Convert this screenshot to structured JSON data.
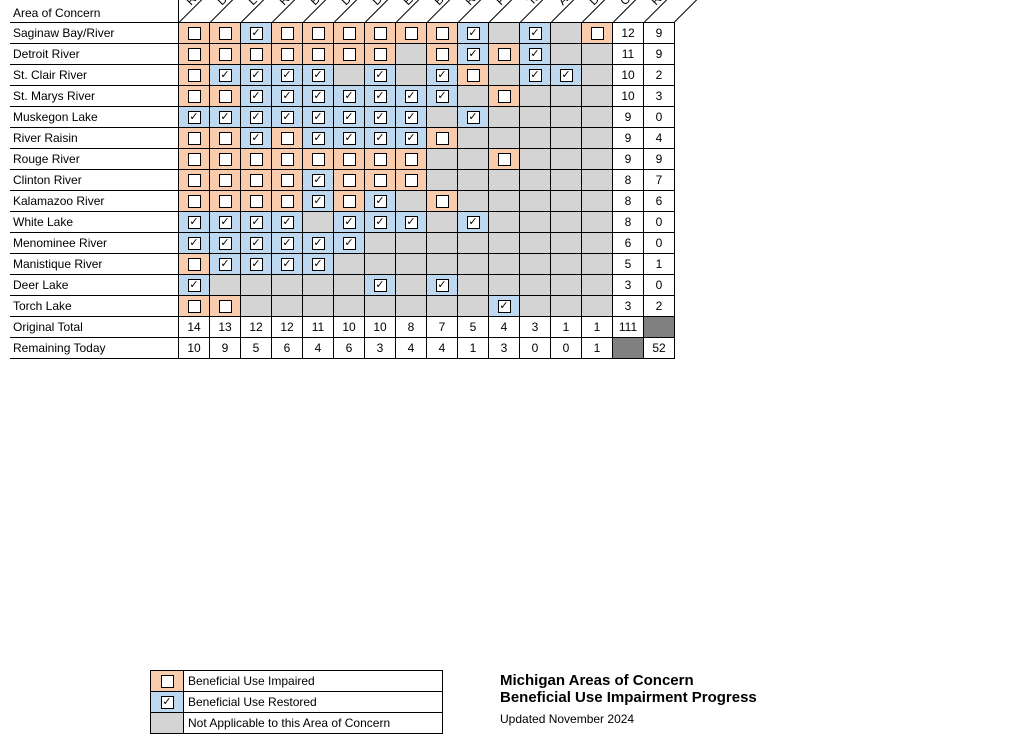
{
  "header_label": "Area of Concern",
  "columns": [
    "Restrictions on Fish and Wildlife Consumption",
    "Degradation of Benthos",
    "Loss of Fish and Wildlife Habitat",
    "Restrictions on Dredging",
    "Beach Closings",
    "Degradation of Fish and Wildlife Populations",
    "Degradation of Aesthetics",
    "Eutrophication or Undesirable Algae",
    "Bird or Animal Deformities or Other Reproductive Problems",
    "Restrictions on Drinking Water Consumption or Taste and Odor Problems",
    "Fish Tumors or Other Deformities",
    "Tainting of Fish and Wildlife Flavor",
    "Added Costs to Agriculture or Industry",
    "Degradation of Phyto- or Zooplankton Populations",
    "Original Total",
    "Remaining Today"
  ],
  "rows": [
    {
      "label": "Saginaw Bay/River",
      "cells": [
        "I",
        "I",
        "R",
        "I",
        "I",
        "I",
        "I",
        "I",
        "I",
        "R",
        "",
        "R",
        "",
        "I"
      ],
      "orig": "12",
      "rem": "9"
    },
    {
      "label": "Detroit River",
      "cells": [
        "I",
        "I",
        "I",
        "I",
        "I",
        "I",
        "I",
        "",
        "I",
        "R",
        "I",
        "R",
        "",
        ""
      ],
      "orig": "11",
      "rem": "9"
    },
    {
      "label": "St. Clair River",
      "cells": [
        "I",
        "R",
        "R",
        "R",
        "R",
        "",
        "R",
        "",
        "R",
        "I",
        "",
        "R",
        "R",
        ""
      ],
      "orig": "10",
      "rem": "2"
    },
    {
      "label": "St. Marys River",
      "cells": [
        "I",
        "I",
        "R",
        "R",
        "R",
        "R",
        "R",
        "R",
        "R",
        "",
        "I",
        "",
        "",
        ""
      ],
      "orig": "10",
      "rem": "3"
    },
    {
      "label": "Muskegon Lake",
      "cells": [
        "R",
        "R",
        "R",
        "R",
        "R",
        "R",
        "R",
        "R",
        "",
        "R",
        "",
        "",
        "",
        ""
      ],
      "orig": "9",
      "rem": "0"
    },
    {
      "label": "River Raisin",
      "cells": [
        "I",
        "I",
        "R",
        "I",
        "R",
        "R",
        "R",
        "R",
        "I",
        "",
        "",
        "",
        "",
        ""
      ],
      "orig": "9",
      "rem": "4"
    },
    {
      "label": "Rouge River",
      "cells": [
        "I",
        "I",
        "I",
        "I",
        "I",
        "I",
        "I",
        "I",
        "",
        "",
        "I",
        "",
        "",
        ""
      ],
      "orig": "9",
      "rem": "9"
    },
    {
      "label": "Clinton River",
      "cells": [
        "I",
        "I",
        "I",
        "I",
        "R",
        "I",
        "I",
        "I",
        "",
        "",
        "",
        "",
        "",
        ""
      ],
      "orig": "8",
      "rem": "7"
    },
    {
      "label": "Kalamazoo River",
      "cells": [
        "I",
        "I",
        "I",
        "I",
        "R",
        "I",
        "R",
        "",
        "I",
        "",
        "",
        "",
        "",
        ""
      ],
      "orig": "8",
      "rem": "6"
    },
    {
      "label": "White Lake",
      "cells": [
        "R",
        "R",
        "R",
        "R",
        "",
        "R",
        "R",
        "R",
        "",
        "R",
        "",
        "",
        "",
        ""
      ],
      "orig": "8",
      "rem": "0"
    },
    {
      "label": "Menominee River",
      "cells": [
        "R",
        "R",
        "R",
        "R",
        "R",
        "R",
        "",
        "",
        "",
        "",
        "",
        "",
        "",
        ""
      ],
      "orig": "6",
      "rem": "0"
    },
    {
      "label": "Manistique River",
      "cells": [
        "I",
        "R",
        "R",
        "R",
        "R",
        "",
        "",
        "",
        "",
        "",
        "",
        "",
        "",
        ""
      ],
      "orig": "5",
      "rem": "1"
    },
    {
      "label": "Deer Lake",
      "cells": [
        "R",
        "",
        "",
        "",
        "",
        "",
        "R",
        "",
        "R",
        "",
        "",
        "",
        "",
        ""
      ],
      "orig": "3",
      "rem": "0"
    },
    {
      "label": "Torch Lake",
      "cells": [
        "I",
        "I",
        "",
        "",
        "",
        "",
        "",
        "",
        "",
        "",
        "R",
        "",
        "",
        ""
      ],
      "orig": "3",
      "rem": "2"
    }
  ],
  "totals": {
    "orig_label": "Original Total",
    "rem_label": "Remaining Today",
    "orig": [
      "14",
      "13",
      "12",
      "12",
      "11",
      "10",
      "10",
      "8",
      "7",
      "5",
      "4",
      "3",
      "1",
      "1"
    ],
    "rem": [
      "10",
      "9",
      "5",
      "6",
      "4",
      "6",
      "3",
      "4",
      "4",
      "1",
      "3",
      "0",
      "0",
      "1"
    ],
    "grand_orig": "111",
    "grand_rem": "52"
  },
  "legend": {
    "impaired": "Beneficial Use Impaired",
    "restored": "Beneficial Use Restored",
    "na": "Not Applicable to this Area of Concern"
  },
  "title": {
    "l1": "Michigan Areas of Concern",
    "l2": "Beneficial Use Impairment Progress",
    "sub": "Updated November 2024"
  },
  "chart_data": {
    "type": "table",
    "row_categories": [
      "Saginaw Bay/River",
      "Detroit River",
      "St. Clair River",
      "St. Marys River",
      "Muskegon Lake",
      "River Raisin",
      "Rouge River",
      "Clinton River",
      "Kalamazoo River",
      "White Lake",
      "Menominee River",
      "Manistique River",
      "Deer Lake",
      "Torch Lake"
    ],
    "col_categories": [
      "Restrictions on Fish and Wildlife Consumption",
      "Degradation of Benthos",
      "Loss of Fish and Wildlife Habitat",
      "Restrictions on Dredging",
      "Beach Closings",
      "Degradation of Fish and Wildlife Populations",
      "Degradation of Aesthetics",
      "Eutrophication or Undesirable Algae",
      "Bird or Animal Deformities or Other Reproductive Problems",
      "Restrictions on Drinking Water Consumption or Taste and Odor Problems",
      "Fish Tumors or Other Deformities",
      "Tainting of Fish and Wildlife Flavor",
      "Added Costs to Agriculture or Industry",
      "Degradation of Phyto- or Zooplankton Populations"
    ],
    "value_legend": {
      "I": "Impaired",
      "R": "Restored",
      "": "Not Applicable"
    },
    "values": [
      [
        "I",
        "I",
        "R",
        "I",
        "I",
        "I",
        "I",
        "I",
        "I",
        "R",
        "",
        "R",
        "",
        "I"
      ],
      [
        "I",
        "I",
        "I",
        "I",
        "I",
        "I",
        "I",
        "",
        "I",
        "R",
        "I",
        "R",
        "",
        ""
      ],
      [
        "I",
        "R",
        "R",
        "R",
        "R",
        "",
        "R",
        "",
        "R",
        "I",
        "",
        "R",
        "R",
        ""
      ],
      [
        "I",
        "I",
        "R",
        "R",
        "R",
        "R",
        "R",
        "R",
        "R",
        "",
        "I",
        "",
        "",
        ""
      ],
      [
        "R",
        "R",
        "R",
        "R",
        "R",
        "R",
        "R",
        "R",
        "",
        "R",
        "",
        "",
        "",
        ""
      ],
      [
        "I",
        "I",
        "R",
        "I",
        "R",
        "R",
        "R",
        "R",
        "I",
        "",
        "",
        "",
        "",
        ""
      ],
      [
        "I",
        "I",
        "I",
        "I",
        "I",
        "I",
        "I",
        "I",
        "",
        "",
        "I",
        "",
        "",
        ""
      ],
      [
        "I",
        "I",
        "I",
        "I",
        "R",
        "I",
        "I",
        "I",
        "",
        "",
        "",
        "",
        "",
        ""
      ],
      [
        "I",
        "I",
        "I",
        "I",
        "R",
        "I",
        "R",
        "",
        "I",
        "",
        "",
        "",
        "",
        ""
      ],
      [
        "R",
        "R",
        "R",
        "R",
        "",
        "R",
        "R",
        "R",
        "",
        "R",
        "",
        "",
        "",
        ""
      ],
      [
        "R",
        "R",
        "R",
        "R",
        "R",
        "R",
        "",
        "",
        "",
        "",
        "",
        "",
        "",
        ""
      ],
      [
        "I",
        "R",
        "R",
        "R",
        "R",
        "",
        "",
        "",
        "",
        "",
        "",
        "",
        "",
        ""
      ],
      [
        "R",
        "",
        "",
        "",
        "",
        "",
        "R",
        "",
        "R",
        "",
        "",
        "",
        "",
        ""
      ],
      [
        "I",
        "I",
        "",
        "",
        "",
        "",
        "",
        "",
        "",
        "",
        "R",
        "",
        "",
        ""
      ]
    ],
    "row_totals_original": [
      12,
      11,
      10,
      10,
      9,
      9,
      9,
      8,
      8,
      8,
      6,
      5,
      3,
      3
    ],
    "row_totals_remaining": [
      9,
      9,
      2,
      3,
      0,
      4,
      9,
      7,
      6,
      0,
      0,
      1,
      0,
      2
    ],
    "col_totals_original": [
      14,
      13,
      12,
      12,
      11,
      10,
      10,
      8,
      7,
      5,
      4,
      3,
      1,
      1
    ],
    "col_totals_remaining": [
      10,
      9,
      5,
      6,
      4,
      6,
      3,
      4,
      4,
      1,
      3,
      0,
      0,
      1
    ],
    "grand_total_original": 111,
    "grand_total_remaining": 52
  }
}
